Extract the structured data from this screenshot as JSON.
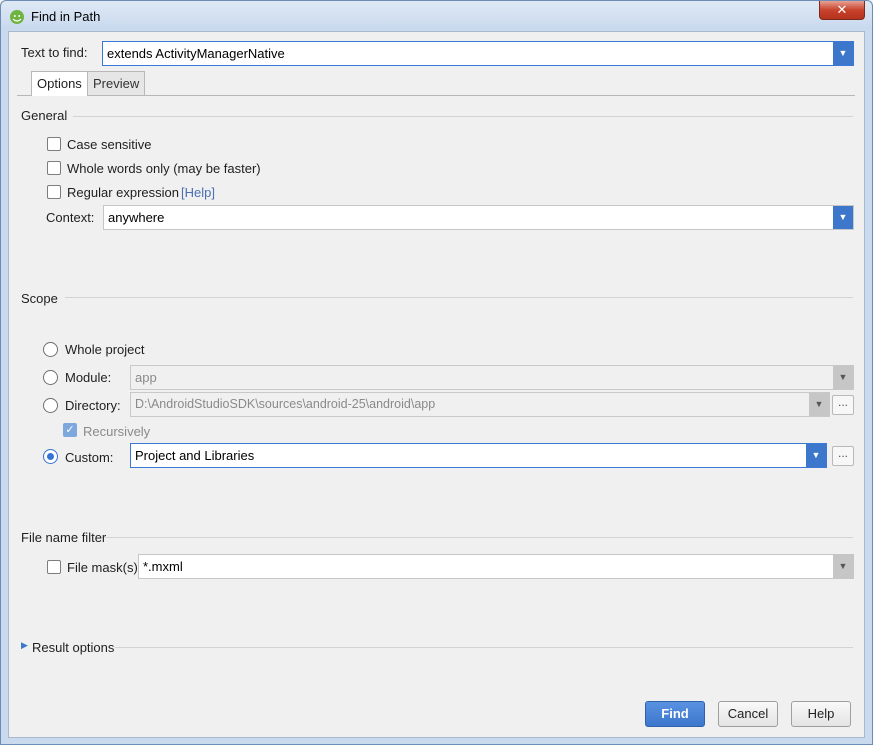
{
  "window": {
    "title": "Find in Path",
    "close_label": "✕"
  },
  "find": {
    "label": "Text to find:",
    "value": "extends ActivityManagerNative"
  },
  "tabs": [
    {
      "label": "Options",
      "active": true
    },
    {
      "label": "Preview",
      "active": false
    }
  ],
  "general": {
    "header": "General",
    "case_sensitive": "Case sensitive",
    "whole_words": "Whole words only (may be faster)",
    "regex": "Regular expression",
    "help_link": "[Help]",
    "context_label": "Context:",
    "context_value": "anywhere"
  },
  "scope": {
    "header": "Scope",
    "whole_project": "Whole project",
    "module_label": "Module:",
    "module_value": "app",
    "directory_label": "Directory:",
    "directory_value": "D:\\AndroidStudioSDK\\sources\\android-25\\android\\app",
    "recursively": "Recursively",
    "custom_label": "Custom:",
    "custom_value": "Project and Libraries",
    "browse": "..."
  },
  "file_filter": {
    "header": "File name filter",
    "mask_label": "File mask(s)",
    "mask_value": "*.mxml"
  },
  "result_options": {
    "label": "Result options"
  },
  "buttons": {
    "find": "Find",
    "cancel": "Cancel",
    "help": "Help"
  },
  "colors": {
    "accent": "#3c77cc",
    "link": "#4a6fb5"
  }
}
